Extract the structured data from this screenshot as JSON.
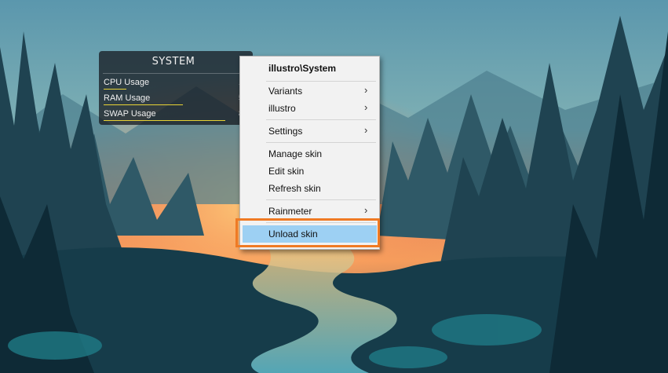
{
  "skin": {
    "title": "SYSTEM",
    "rows": [
      {
        "label": "CPU Usage",
        "value": "16",
        "usage": 0.16
      },
      {
        "label": "RAM Usage",
        "value": "56",
        "usage": 0.56
      },
      {
        "label": "SWAP Usage",
        "value": "86",
        "usage": 0.86
      }
    ],
    "bar_color": "#e8d335"
  },
  "context_menu": {
    "title": "illustro\\System",
    "items": {
      "variants": "Variants",
      "illustro": "illustro",
      "settings": "Settings",
      "manage_skin": "Manage skin",
      "edit_skin": "Edit skin",
      "refresh_skin": "Refresh skin",
      "rainmeter": "Rainmeter",
      "unload_skin": "Unload skin"
    },
    "submenu_arrow": "›",
    "highlighted_item": "Unload skin",
    "highlight_color": "#9dd0f3",
    "annotation_color": "#ef7a24"
  }
}
